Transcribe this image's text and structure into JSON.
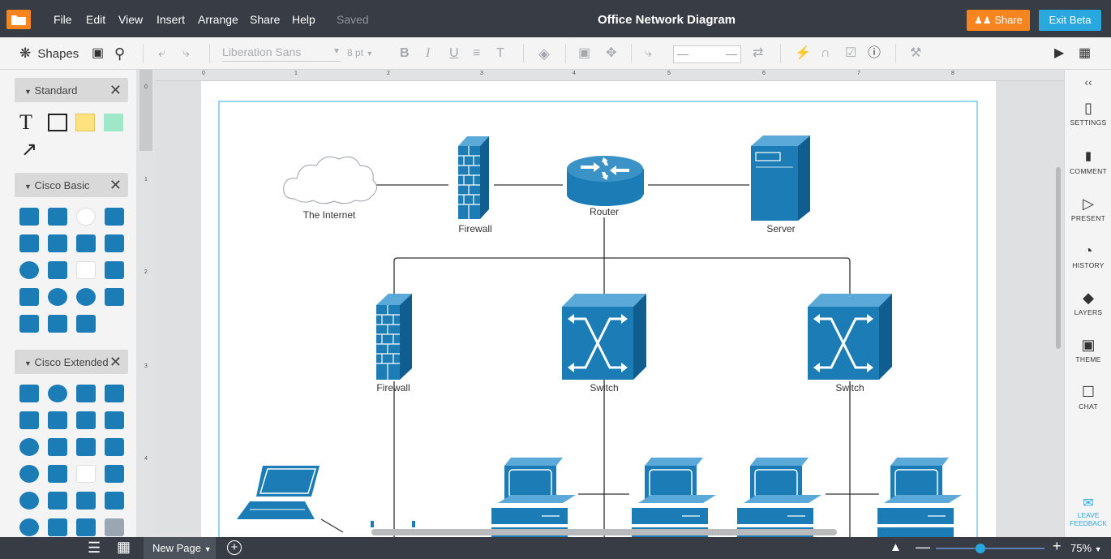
{
  "app": {
    "title": "Office Network Diagram",
    "save_status": "Saved",
    "menus": [
      "File",
      "Edit",
      "View",
      "Insert",
      "Arrange",
      "Share",
      "Help"
    ],
    "share_label": "Share",
    "exit_beta_label": "Exit Beta",
    "colors": {
      "topbar": "#383d45",
      "share": "#f6851f",
      "exit_beta": "#29a8e0",
      "shape": "#1c7db6"
    }
  },
  "toolbar": {
    "shapes_label": "Shapes",
    "font_family": "Liberation Sans",
    "font_size": "8",
    "font_size_unit": "pt"
  },
  "left_panel": {
    "libraries": [
      {
        "name": "Standard"
      },
      {
        "name": "Cisco Basic"
      },
      {
        "name": "Cisco Extended"
      }
    ]
  },
  "ruler": {
    "h_ticks": [
      "0",
      "1",
      "2",
      "3",
      "4",
      "5",
      "6",
      "7",
      "8"
    ],
    "v_ticks": [
      "0",
      "1",
      "2",
      "3",
      "4"
    ]
  },
  "diagram": {
    "labels": {
      "internet": "The Internet",
      "firewall_top": "Firewall",
      "router": "Router",
      "server": "Server",
      "firewall_left": "Firewall",
      "switch_mid": "Switch",
      "switch_right": "Switch"
    }
  },
  "right_panel": {
    "items": [
      {
        "icon": "settings-icon",
        "label": "SETTINGS"
      },
      {
        "icon": "comment-icon",
        "label": "COMMENT"
      },
      {
        "icon": "present-icon",
        "label": "PRESENT"
      },
      {
        "icon": "history-icon",
        "label": "HISTORY"
      },
      {
        "icon": "layers-icon",
        "label": "LAYERS"
      },
      {
        "icon": "theme-icon",
        "label": "THEME"
      },
      {
        "icon": "chat-icon",
        "label": "CHAT"
      }
    ],
    "feedback_line1": "LEAVE",
    "feedback_line2": "FEEDBACK"
  },
  "bottom": {
    "page_name": "New Page",
    "zoom": "75%",
    "zoom_level_fraction": 0.37
  }
}
